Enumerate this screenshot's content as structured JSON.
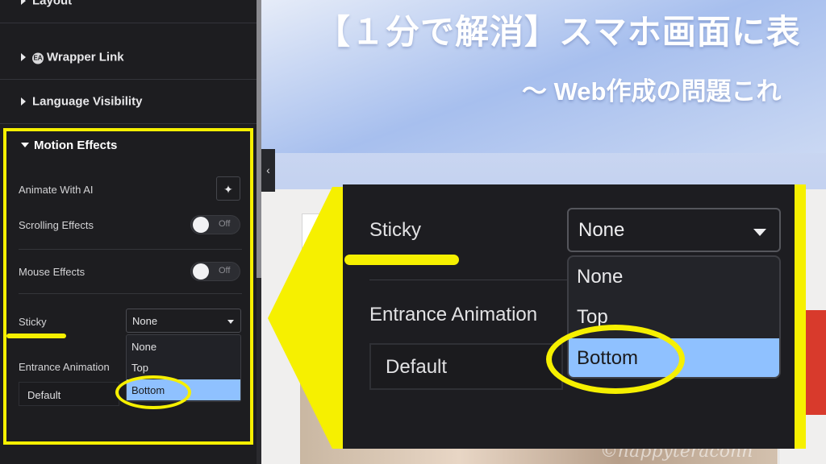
{
  "sidebar": {
    "sections": [
      {
        "label": "Layout"
      },
      {
        "label": "Wrapper Link",
        "badge": "EA"
      },
      {
        "label": "Language Visibility"
      }
    ],
    "motion_effects": {
      "title": "Motion Effects",
      "animate_ai_label": "Animate With AI",
      "scrolling_label": "Scrolling Effects",
      "scrolling_state": "Off",
      "mouse_label": "Mouse Effects",
      "mouse_state": "Off",
      "sticky_label": "Sticky",
      "sticky_value": "None",
      "sticky_options": [
        "None",
        "Top",
        "Bottom"
      ],
      "sticky_highlighted": "Bottom",
      "entrance_label": "Entrance Animation",
      "entrance_value": "Default"
    }
  },
  "preview": {
    "title": "【１分で解消】スマホ画面に表",
    "subtitle": "〜 Web作成の問題これ",
    "watermark": "©happyteraconn"
  },
  "zoom": {
    "sticky_label": "Sticky",
    "sticky_value": "None",
    "options": [
      "None",
      "Top",
      "Bottom"
    ],
    "entrance_label": "Entrance Animation",
    "entrance_value": "Default"
  },
  "colors": {
    "annotation": "#f6f000",
    "highlight": "#8fc1ff",
    "panel": "#1d1d20"
  },
  "icons": {
    "collapse": "chevron-left-icon",
    "ai": "sparkle-icon"
  }
}
